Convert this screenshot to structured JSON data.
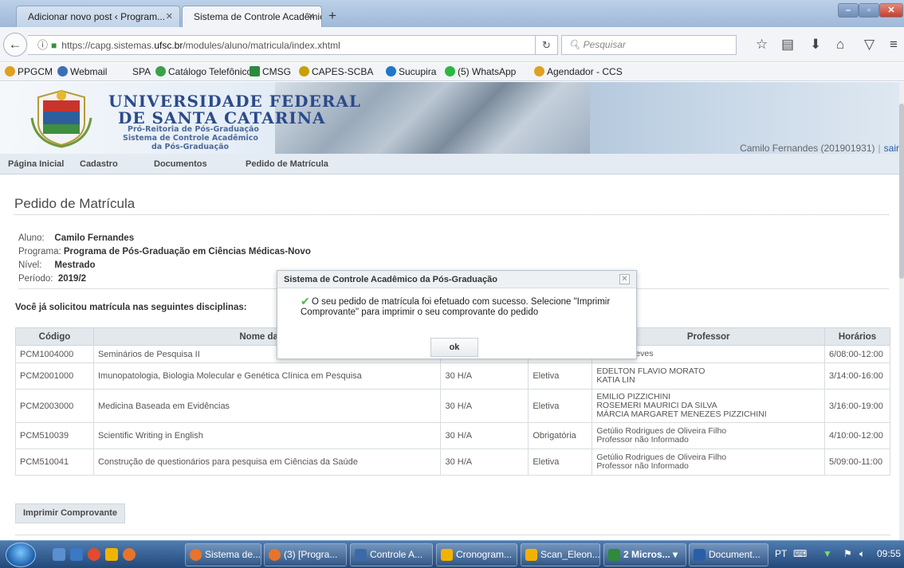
{
  "browser": {
    "tabs": [
      {
        "label": "Adicionar novo post ‹ Program...",
        "active": false
      },
      {
        "label": "Sistema de Controle Acadêmic...",
        "active": true
      }
    ],
    "url_prefix": "https://capg.sistemas.",
    "url_domain": "ufsc.br",
    "url_path": "/modules/aluno/matricula/index.xhtml",
    "search_placeholder": "Pesquisar",
    "bookmarks": [
      {
        "label": "PPGCM",
        "color": "#e0a020"
      },
      {
        "label": "Webmail",
        "color": "#3b6fb5"
      },
      {
        "label": "SPA",
        "color": ""
      },
      {
        "label": "Catálogo Telefônico",
        "color": "#3ca04a"
      },
      {
        "label": "CMSG",
        "color": "#2d8a3e"
      },
      {
        "label": "CAPES-SCBA",
        "color": "#c8a000"
      },
      {
        "label": "Sucupira",
        "color": "#1f77c8"
      },
      {
        "label": "(5) WhatsApp",
        "color": "#2bb741"
      },
      {
        "label": "Agendador - CCS",
        "color": "#e0a020"
      }
    ]
  },
  "banner": {
    "line1": "UNIVERSIDADE FEDERAL",
    "line2": "DE SANTA CATARINA",
    "sub1": "Pró-Reitoria de Pós-Graduação",
    "sub2": "Sistema de Controle Acadêmico",
    "sub3": "da Pós-Graduação",
    "user": "Camilo Fernandes (201901931)",
    "separator": "|",
    "logout": "sair"
  },
  "menu": [
    "Página Inicial",
    "Cadastro",
    "Documentos",
    "Pedido de Matrícula"
  ],
  "page": {
    "title": "Pedido de Matrícula",
    "aluno_label": "Aluno:",
    "aluno": "Camilo Fernandes",
    "programa_label": "Programa:",
    "programa": "Programa de Pós-Graduação em Ciências Médicas-Novo",
    "nivel_label": "Nível:",
    "nivel": "Mestrado",
    "periodo_label": "Período:",
    "periodo": "2019/2",
    "section": "Você já solicitou matrícula nas seguintes disciplinas:",
    "print_button": "Imprimir Comprovante"
  },
  "table": {
    "headers": [
      "Código",
      "Nome da Dis",
      "Professor",
      "Horários"
    ],
    "rows": [
      {
        "code": "PCM1004000",
        "name": "Seminários de Pesquisa II",
        "hours": "",
        "type": "",
        "prof1": "e Souza Neves",
        "prof2": "",
        "prof3": "",
        "sched": "6/08:00-12:00"
      },
      {
        "code": "PCM2001000",
        "name": "Imunopatologia, Biologia Molecular e Genética Clínica em Pesquisa",
        "hours": "30 H/A",
        "type": "Eletiva",
        "prof1": "EDELTON FLAVIO MORATO",
        "prof2": "KATIA LIN",
        "prof3": "",
        "sched": "3/14:00-16:00"
      },
      {
        "code": "PCM2003000",
        "name": "Medicina Baseada em Evidências",
        "hours": "30 H/A",
        "type": "Eletiva",
        "prof1": "EMILIO PIZZICHINI",
        "prof2": "ROSEMERI MAURICI DA SILVA",
        "prof3": "MÁRCIA MARGARET MENEZES PIZZICHINI",
        "sched": "3/16:00-19:00"
      },
      {
        "code": "PCM510039",
        "name": "Scientific Writing in English",
        "hours": "30 H/A",
        "type": "Obrigatória",
        "prof1": "Getúlio Rodrigues de Oliveira Filho",
        "prof2": "Professor não Informado",
        "prof3": "",
        "sched": "4/10:00-12:00"
      },
      {
        "code": "PCM510041",
        "name": "Construção de questionários para pesquisa em Ciências da Saúde",
        "hours": "30 H/A",
        "type": "Eletiva",
        "prof1": "Getúlio Rodrigues de Oliveira Filho",
        "prof2": "Professor não Informado",
        "prof3": "",
        "sched": "5/09:00-11:00"
      }
    ]
  },
  "modal": {
    "title": "Sistema de Controle Acadêmico da Pós-Graduação",
    "message": "O seu pedido de matrícula foi efetuado com sucesso. Selecione \"Imprimir Comprovante\" para imprimir o seu comprovante do pedido",
    "ok": "ok"
  },
  "taskbar": {
    "tasks": [
      {
        "label": "Sistema de...",
        "color": "#e8742a"
      },
      {
        "label": "(3) [Progra...",
        "color": "#e8742a"
      },
      {
        "label": "Controle A...",
        "color": "#3c6aa8"
      },
      {
        "label": "Cronogram...",
        "color": "#f2b300"
      },
      {
        "label": "Scan_Eleon...",
        "color": "#f2b300"
      },
      {
        "label": "2 Micros...",
        "color": "#2f8a3c"
      },
      {
        "label": "Document...",
        "color": "#2a5ea8"
      }
    ],
    "lang": "PT",
    "time": "09:55"
  }
}
